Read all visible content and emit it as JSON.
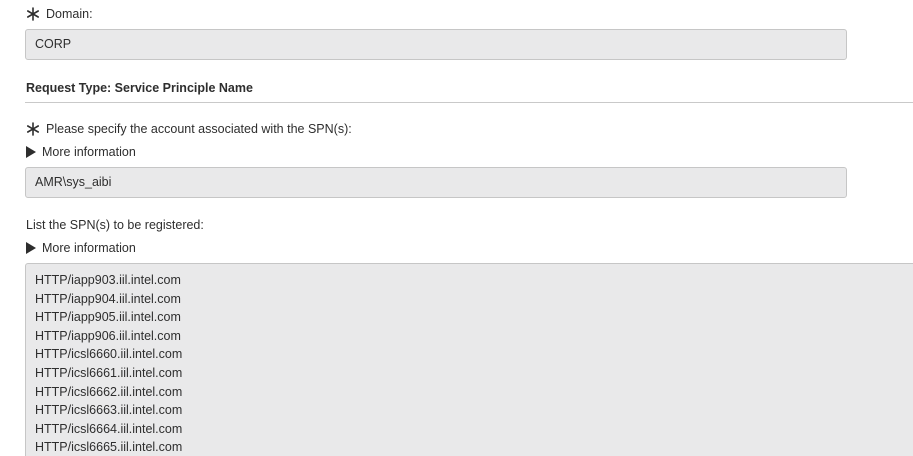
{
  "domain": {
    "label": "Domain:",
    "value": "CORP",
    "mandatory": true
  },
  "request_type": {
    "title": "Request Type: Service Principle Name"
  },
  "account": {
    "label": "Please specify the account associated with the SPN(s):",
    "mandatory": true,
    "more_info": "More information",
    "value": "AMR\\sys_aibi"
  },
  "spn_list": {
    "label": "List the SPN(s) to be registered:",
    "more_info": "More information",
    "lines": [
      "HTTP/iapp903.iil.intel.com",
      "HTTP/iapp904.iil.intel.com",
      "HTTP/iapp905.iil.intel.com",
      "HTTP/iapp906.iil.intel.com",
      "HTTP/icsl6660.iil.intel.com",
      "HTTP/icsl6661.iil.intel.com",
      "HTTP/icsl6662.iil.intel.com",
      "HTTP/icsl6663.iil.intel.com",
      "HTTP/icsl6664.iil.intel.com",
      "HTTP/icsl6665.iil.intel.com"
    ]
  },
  "colors": {
    "input_background": "#e9e9ea",
    "input_border": "#c6c6c6",
    "text": "#2e2e2e",
    "divider": "#c9c9c9"
  },
  "icons": {
    "mandatory": "asterisk-icon",
    "expand": "triangle-right-icon"
  }
}
